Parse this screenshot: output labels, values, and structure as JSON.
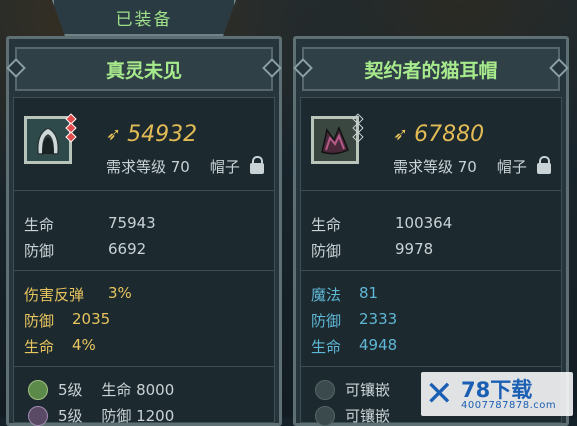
{
  "header": {
    "tab_label": "已装备"
  },
  "left": {
    "name": "真灵未见",
    "score": "54932",
    "requirement": "需求等级 70",
    "slot": "帽子",
    "base_stats": [
      {
        "label": "生命",
        "value": "75943"
      },
      {
        "label": "防御",
        "value": "6692"
      }
    ],
    "extra_stats": [
      {
        "label": "伤害反弹",
        "value": "3%"
      },
      {
        "label": "防御",
        "value": "2035"
      },
      {
        "label": "生命",
        "value": "4%"
      }
    ],
    "sockets": [
      {
        "text": "5级",
        "detail": "生命 8000"
      },
      {
        "text": "5级",
        "detail": "防御 1200"
      }
    ]
  },
  "right": {
    "name": "契约者的猫耳帽",
    "score": "67880",
    "requirement": "需求等级 70",
    "slot": "帽子",
    "base_stats": [
      {
        "label": "生命",
        "value": "100364"
      },
      {
        "label": "防御",
        "value": "9978"
      }
    ],
    "extra_stats": [
      {
        "label": "魔法",
        "value": "81"
      },
      {
        "label": "防御",
        "value": "2333"
      },
      {
        "label": "生命",
        "value": "4948"
      }
    ],
    "sockets": [
      {
        "text": "可镶嵌"
      },
      {
        "text": "可镶嵌"
      }
    ]
  },
  "watermark": {
    "brand": "78下载",
    "sub": "4007787878.com"
  },
  "colors": {
    "title_green": "#a7ea8c",
    "score_gold": "#e2bb55",
    "extra_yellow": "#e8c55e",
    "extra_cyan": "#5fb7d6"
  }
}
